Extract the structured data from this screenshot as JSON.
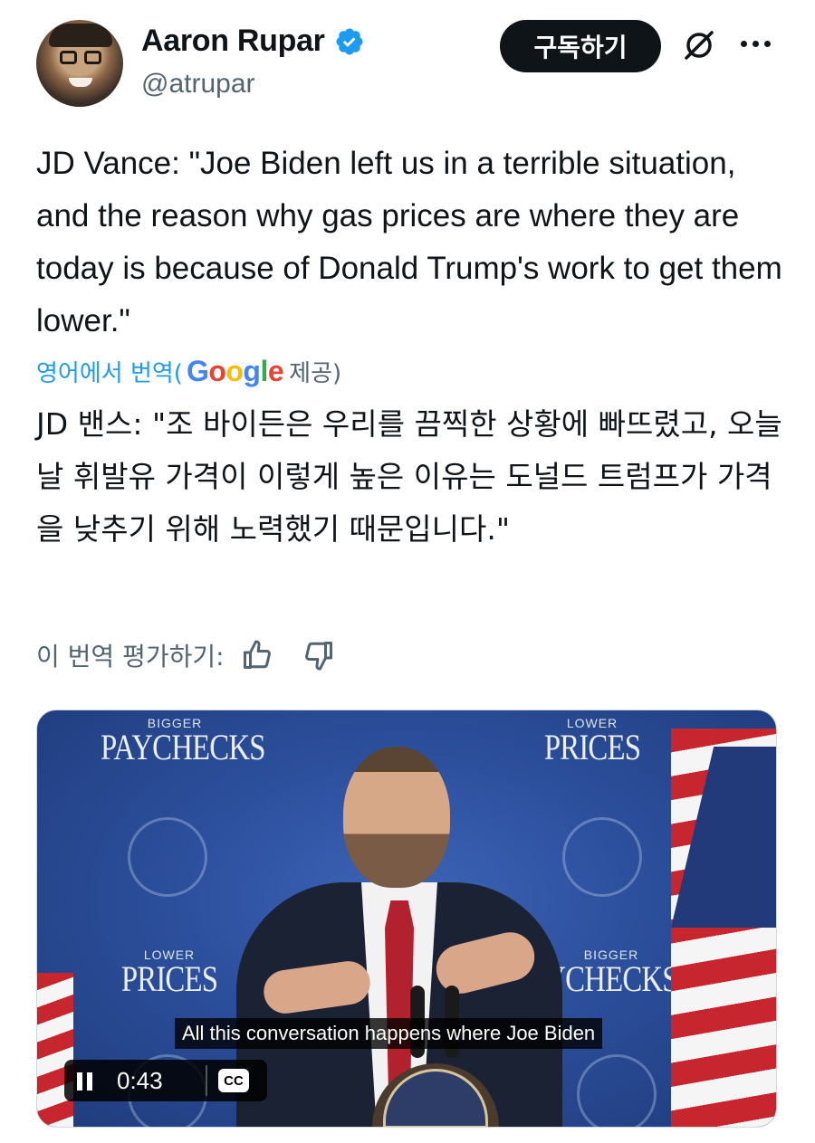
{
  "author": {
    "display_name": "Aaron Rupar",
    "handle": "@atrupar",
    "verified": true
  },
  "header": {
    "subscribe_label": "구독하기",
    "icons": [
      "verified-badge-icon",
      "grok-icon",
      "more-icon"
    ]
  },
  "tweet": {
    "text": "JD Vance: \"Joe Biden left us in a terrible situation, and the reason why gas prices are where they are today is because of Donald Trump's work to get them lower.\"",
    "translate_prefix": "영어에서 번역(",
    "translate_provider": "Google",
    "translate_suffix": "제공)",
    "translated_text": "JD 밴스: \"조 바이든은 우리를 끔찍한 상황에 빠뜨렸고, 오늘날 휘발유 가격이 이렇게 높은 이유는 도널드 트럼프가 가격을 낮추기 위해 노력했기 때문입니다.\"",
    "rate_label": "이 번역 평가하기:"
  },
  "video": {
    "sign_top_left_small": "BIGGER",
    "sign_top_left_big": "PAYCHECKS",
    "sign_top_right_small": "LOWER",
    "sign_top_right_big": "PRICES",
    "sign_mid_left_small": "LOWER",
    "sign_mid_left_big": "PRICES",
    "sign_mid_right_small": "BIGGER",
    "sign_mid_right_big": "YCHECKS",
    "caption": "All this conversation happens where Joe Biden",
    "timecode": "0:43",
    "cc_label": "CC",
    "state": "playing"
  },
  "colors": {
    "link_blue": "#1d9bf0",
    "text_primary": "#0f1419",
    "text_secondary": "#536471",
    "button_dark": "#0f1419"
  }
}
